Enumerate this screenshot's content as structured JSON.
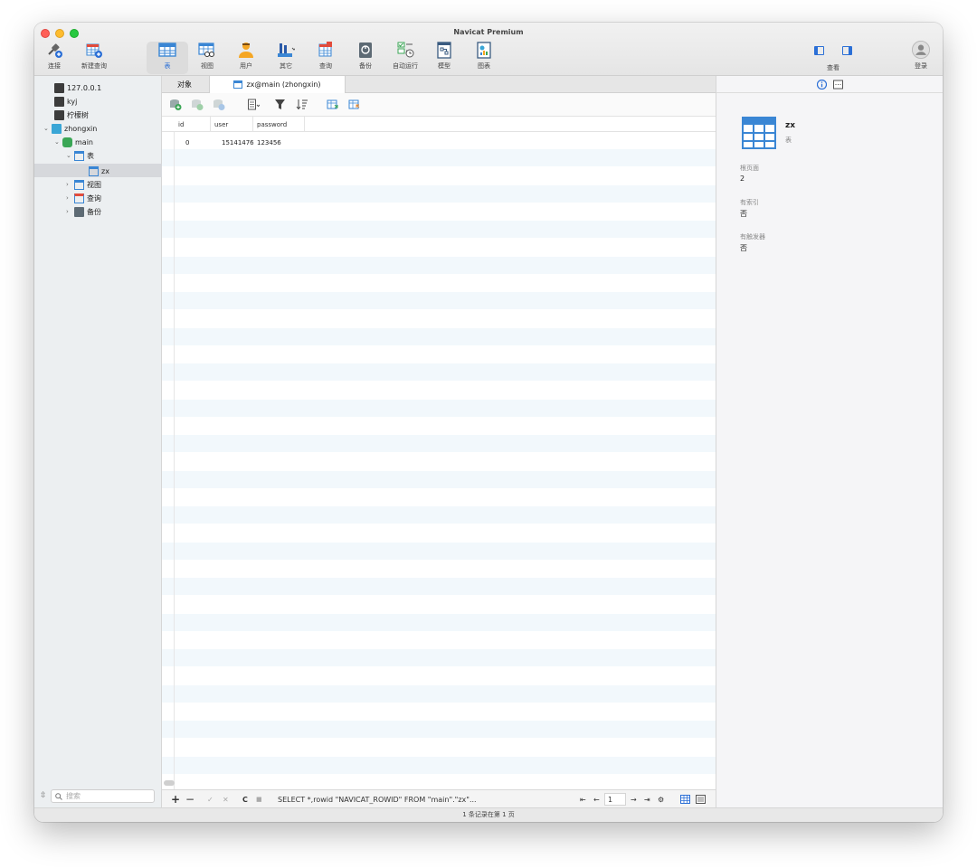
{
  "window": {
    "title": "Navicat Premium"
  },
  "toolbar": {
    "items": [
      {
        "label": "连接"
      },
      {
        "label": "新建查询"
      },
      {
        "label": "表"
      },
      {
        "label": "视图"
      },
      {
        "label": "用户"
      },
      {
        "label": "其它"
      },
      {
        "label": "查询"
      },
      {
        "label": "备份"
      },
      {
        "label": "自动运行"
      },
      {
        "label": "模型"
      },
      {
        "label": "图表"
      }
    ],
    "view_label": "查看",
    "login_label": "登录"
  },
  "sidebar": {
    "connections": [
      "127.0.0.1",
      "kyj",
      "柠檬树",
      "zhongxin"
    ],
    "database": "main",
    "tables_group": "表",
    "table": "zx",
    "views_group": "视图",
    "queries_group": "查询",
    "backups_group": "备份",
    "search_placeholder": "搜索"
  },
  "tabs": {
    "objects_label": "对象",
    "active_tab_label": "zx@main (zhongxin)"
  },
  "grid": {
    "columns": [
      "id",
      "user",
      "password"
    ],
    "rows": [
      {
        "id": "0",
        "user": "15141476",
        "password": "123456"
      }
    ]
  },
  "bottombar": {
    "add": "+",
    "remove": "−",
    "apply": "✓",
    "discard": "✕",
    "refresh": "C",
    "stop": "■",
    "sql": "SELECT *,rowid \"NAVICAT_ROWID\" FROM \"main\".\"zx\"...",
    "first": "⇤",
    "prev": "←",
    "page": "1",
    "next": "→",
    "last": "⇥",
    "settings": "⚙"
  },
  "status": {
    "text": "1 条记录在第 1 页"
  },
  "info_panel": {
    "name": "zx",
    "type": "表",
    "fields": [
      {
        "label": "根页面",
        "value": "2"
      },
      {
        "label": "有索引",
        "value": "否"
      },
      {
        "label": "有触发器",
        "value": "否"
      }
    ]
  },
  "colors": {
    "accent": "#2b6fd6",
    "table_icon": "#3a86d4",
    "stripe": "#f2f8fc"
  }
}
